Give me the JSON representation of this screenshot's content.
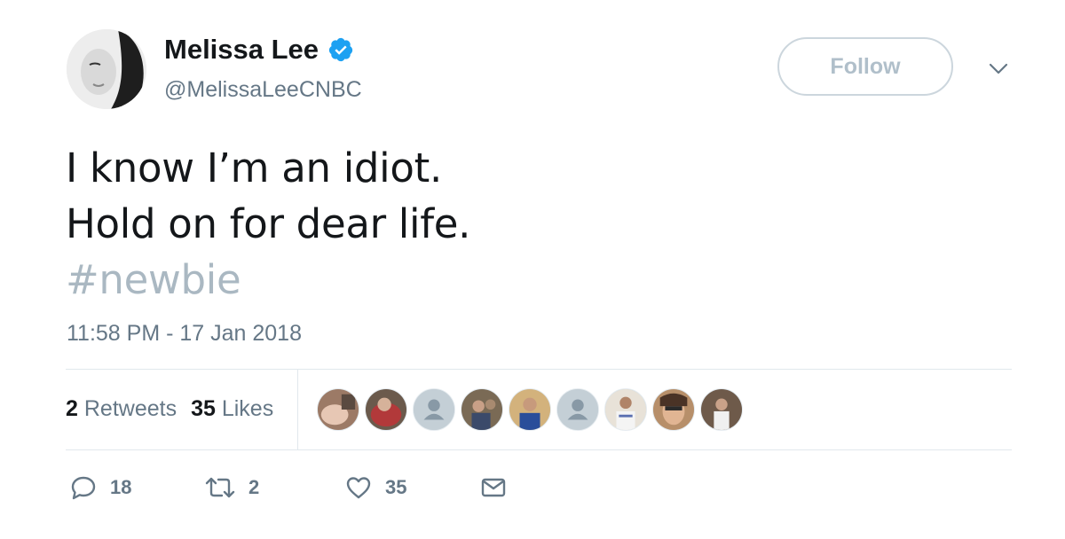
{
  "user": {
    "display_name": "Melissa Lee",
    "handle": "@MelissaLeeCNBC",
    "verified": true
  },
  "follow_button_label": "Follow",
  "tweet": {
    "lines": [
      "I know I’m an idiot.",
      "Hold on for dear life."
    ],
    "hashtag": "#newbie"
  },
  "timestamp": "11:58 PM - 17 Jan 2018",
  "stats": {
    "retweets_count": "2",
    "retweets_label": "Retweets",
    "likes_count": "35",
    "likes_label": "Likes"
  },
  "liker_avatars": 9,
  "actions": {
    "reply_count": "18",
    "retweet_count": "2",
    "like_count": "35"
  },
  "colors": {
    "text": "#14171a",
    "secondary": "#657786",
    "hashtag": "#aab8c2",
    "verified": "#1da1f2",
    "border": "#e1e8ed"
  }
}
